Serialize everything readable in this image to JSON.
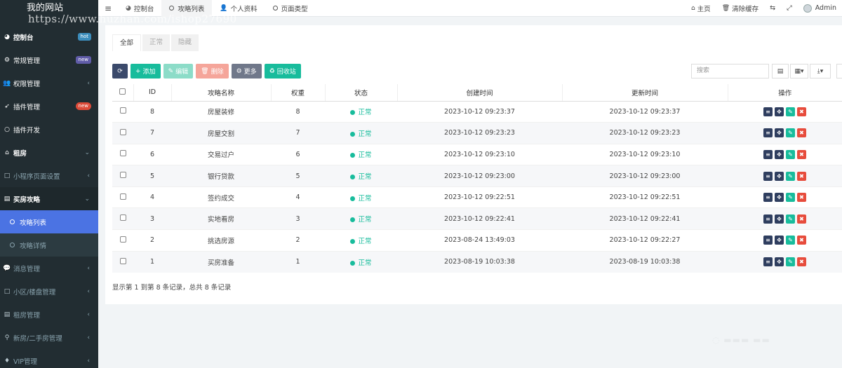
{
  "site": {
    "name": "我的网站",
    "watermark": "https://www.huzhan.com/ishop27690"
  },
  "sidebar": {
    "items": [
      {
        "label": "控制台",
        "icon": "dashboard-icon",
        "glyph": "◕",
        "badge": "hot"
      },
      {
        "label": "常规管理",
        "icon": "cogs-icon",
        "glyph": "⚙",
        "badge": "new"
      },
      {
        "label": "权限管理",
        "icon": "users-icon",
        "glyph": "👥",
        "chevron": "‹"
      },
      {
        "label": "插件管理",
        "icon": "rocket-icon",
        "glyph": "➶",
        "badge": "new"
      },
      {
        "label": "插件开发",
        "icon": "circle-icon",
        "glyph": "○"
      },
      {
        "label": "租房",
        "icon": "home-icon",
        "glyph": "⌂",
        "chevron": "⌄"
      },
      {
        "label": "小程序页面设置",
        "icon": "square-icon",
        "glyph": "□",
        "chevron": "‹"
      },
      {
        "label": "买房攻略",
        "icon": "file-icon",
        "glyph": "▤",
        "chevron": "⌄"
      },
      {
        "label": "攻略列表",
        "icon": "circle-icon"
      },
      {
        "label": "攻略详情",
        "icon": "circle-icon"
      },
      {
        "label": "消息管理",
        "icon": "comment-icon",
        "glyph": "💬",
        "chevron": "‹"
      },
      {
        "label": "小区/楼盘管理",
        "icon": "square-icon",
        "glyph": "□",
        "chevron": "‹"
      },
      {
        "label": "租房管理",
        "icon": "file-icon",
        "glyph": "▤",
        "chevron": "‹"
      },
      {
        "label": "新房/二手房管理",
        "icon": "map-marker-icon",
        "glyph": "⚲",
        "chevron": "‹"
      },
      {
        "label": "VIP管理",
        "icon": "diamond-icon",
        "glyph": "♦",
        "chevron": "‹"
      }
    ]
  },
  "topbar": {
    "tabs": [
      {
        "label": "控制台",
        "icon": "dashboard-icon"
      },
      {
        "label": "攻略列表",
        "icon": "circle-icon"
      },
      {
        "label": "个人资料",
        "icon": "user-icon"
      },
      {
        "label": "页面类型",
        "icon": "circle-icon"
      }
    ],
    "home_label": "主页",
    "clear_cache_label": "清除缓存",
    "user_label": "Admin"
  },
  "filters": [
    "全部",
    "正常",
    "隐藏"
  ],
  "toolbar": {
    "add": "添加",
    "edit": "编辑",
    "delete": "删除",
    "more": "更多",
    "recycle": "回收站",
    "search_placeholder": "搜索"
  },
  "table": {
    "columns": [
      "ID",
      "攻略名称",
      "权重",
      "状态",
      "创建时间",
      "更新时间",
      "操作"
    ],
    "rows": [
      {
        "id": "8",
        "name": "房屋装修",
        "weight": "8",
        "status": "正常",
        "created": "2023-10-12 09:23:37",
        "updated": "2023-10-12 09:23:37"
      },
      {
        "id": "7",
        "name": "房屋交割",
        "weight": "7",
        "status": "正常",
        "created": "2023-10-12 09:23:23",
        "updated": "2023-10-12 09:23:23"
      },
      {
        "id": "6",
        "name": "交易过户",
        "weight": "6",
        "status": "正常",
        "created": "2023-10-12 09:23:10",
        "updated": "2023-10-12 09:23:10"
      },
      {
        "id": "5",
        "name": "银行贷款",
        "weight": "5",
        "status": "正常",
        "created": "2023-10-12 09:23:00",
        "updated": "2023-10-12 09:23:00"
      },
      {
        "id": "4",
        "name": "签约成交",
        "weight": "4",
        "status": "正常",
        "created": "2023-10-12 09:22:51",
        "updated": "2023-10-12 09:22:51"
      },
      {
        "id": "3",
        "name": "实地看房",
        "weight": "3",
        "status": "正常",
        "created": "2023-10-12 09:22:41",
        "updated": "2023-10-12 09:22:41"
      },
      {
        "id": "2",
        "name": "挑选房源",
        "weight": "2",
        "status": "正常",
        "created": "2023-08-24 13:49:03",
        "updated": "2023-10-12 09:22:27"
      },
      {
        "id": "1",
        "name": "买房准备",
        "weight": "1",
        "status": "正常",
        "created": "2023-08-19 10:03:38",
        "updated": "2023-08-19 10:03:38"
      }
    ]
  },
  "pagination_info": "显示第 1 到第 8 条记录，总共 8 条记录",
  "colors": {
    "sidebar_bg": "#222d32",
    "active_item": "#4b73e3",
    "success": "#18bc9c",
    "danger": "#e74c3c"
  }
}
